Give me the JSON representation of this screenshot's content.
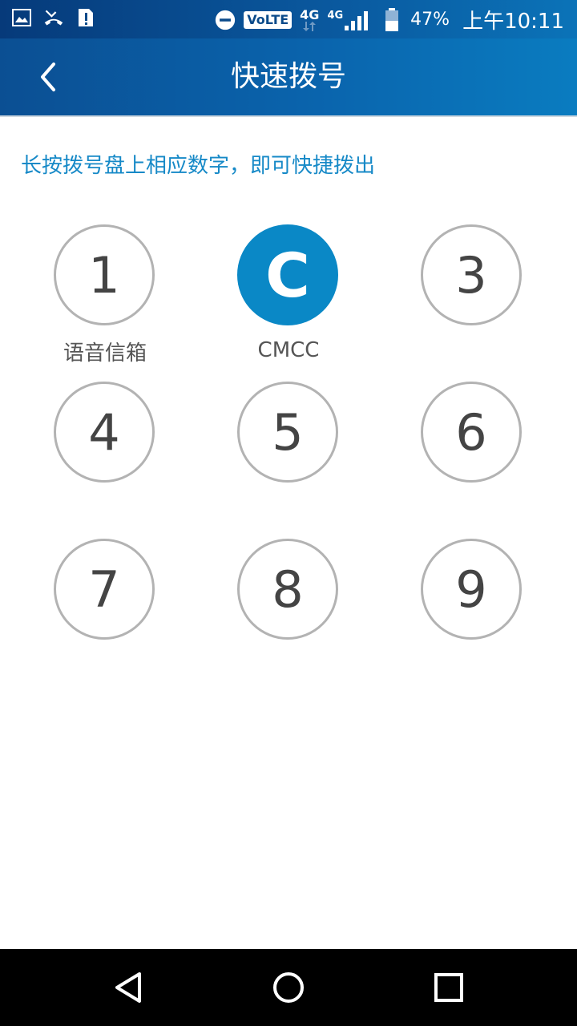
{
  "status_bar": {
    "volte": "VoLTE",
    "net_1": "4G",
    "net_2": "4G",
    "battery": "47%",
    "time": "上午10:11",
    "icons": [
      "image-icon",
      "missed-call-icon",
      "sim-alert-icon",
      "do-not-disturb-icon",
      "signal-icon",
      "battery-icon"
    ]
  },
  "app_bar": {
    "title": "快速拨号",
    "back_icon": "chevron-left-icon"
  },
  "hint": "长按拨号盘上相应数字，即可快捷拨出",
  "keys": [
    {
      "digit": "1",
      "label": "语音信箱"
    },
    {
      "digit": "C",
      "label": "CMCC"
    },
    {
      "digit": "3",
      "label": ""
    },
    {
      "digit": "4",
      "label": ""
    },
    {
      "digit": "5",
      "label": ""
    },
    {
      "digit": "6",
      "label": ""
    },
    {
      "digit": "7",
      "label": ""
    },
    {
      "digit": "8",
      "label": ""
    },
    {
      "digit": "9",
      "label": ""
    }
  ],
  "colors": {
    "accent": "#0a88c6",
    "hint": "#1689c7",
    "appbar": "#0a64ad",
    "key_border": "#b3b3b3"
  },
  "nav": {
    "back": "triangle-back-icon",
    "home": "circle-home-icon",
    "recents": "square-recents-icon"
  }
}
